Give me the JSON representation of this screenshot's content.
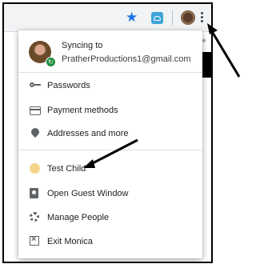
{
  "toolbar": {
    "icons": [
      "star-icon",
      "cloud-extension-icon",
      "profile-avatar-icon",
      "more-vert-icon"
    ],
    "overflow_chevron": "»"
  },
  "profile": {
    "title": "Syncing to",
    "email": "PratherProductions1@gmail.com",
    "sync_badge": "sync-icon"
  },
  "menu": {
    "items": [
      {
        "label": "Passwords",
        "icon": "key-icon"
      },
      {
        "label": "Payment methods",
        "icon": "credit-card-icon"
      },
      {
        "label": "Addresses and more",
        "icon": "location-pin-icon"
      }
    ],
    "people": [
      {
        "label": "Test Child",
        "icon": "face-avatar-icon"
      },
      {
        "label": "Open Guest Window",
        "icon": "guest-badge-icon"
      },
      {
        "label": "Manage People",
        "icon": "gear-icon"
      },
      {
        "label": "Exit Monica",
        "icon": "exit-icon"
      }
    ]
  },
  "colors": {
    "accent": "#1a73e8",
    "sync_green": "#1e8e3e",
    "annotation": "#000000"
  }
}
